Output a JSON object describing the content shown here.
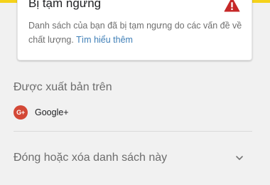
{
  "colors": {
    "top_strip": "#f5d21a",
    "warning_icon": "#c62828",
    "link": "#3f7fb7",
    "google_plus": "#d34836"
  },
  "warning_card": {
    "title": "Bị tạm ngưng",
    "icon": "warning-triangle-icon",
    "description": "Danh sách của bạn đã bị tạm ngưng do các vấn đề về chất lượng.",
    "learn_more": "Tìm hiểu thêm"
  },
  "published": {
    "heading": "Được xuất bản trên",
    "items": [
      {
        "icon": "google-plus-icon",
        "icon_text": "G+",
        "label": "Google+"
      }
    ]
  },
  "close_section": {
    "label": "Đóng hoặc xóa danh sách này",
    "icon": "chevron-down-icon"
  }
}
